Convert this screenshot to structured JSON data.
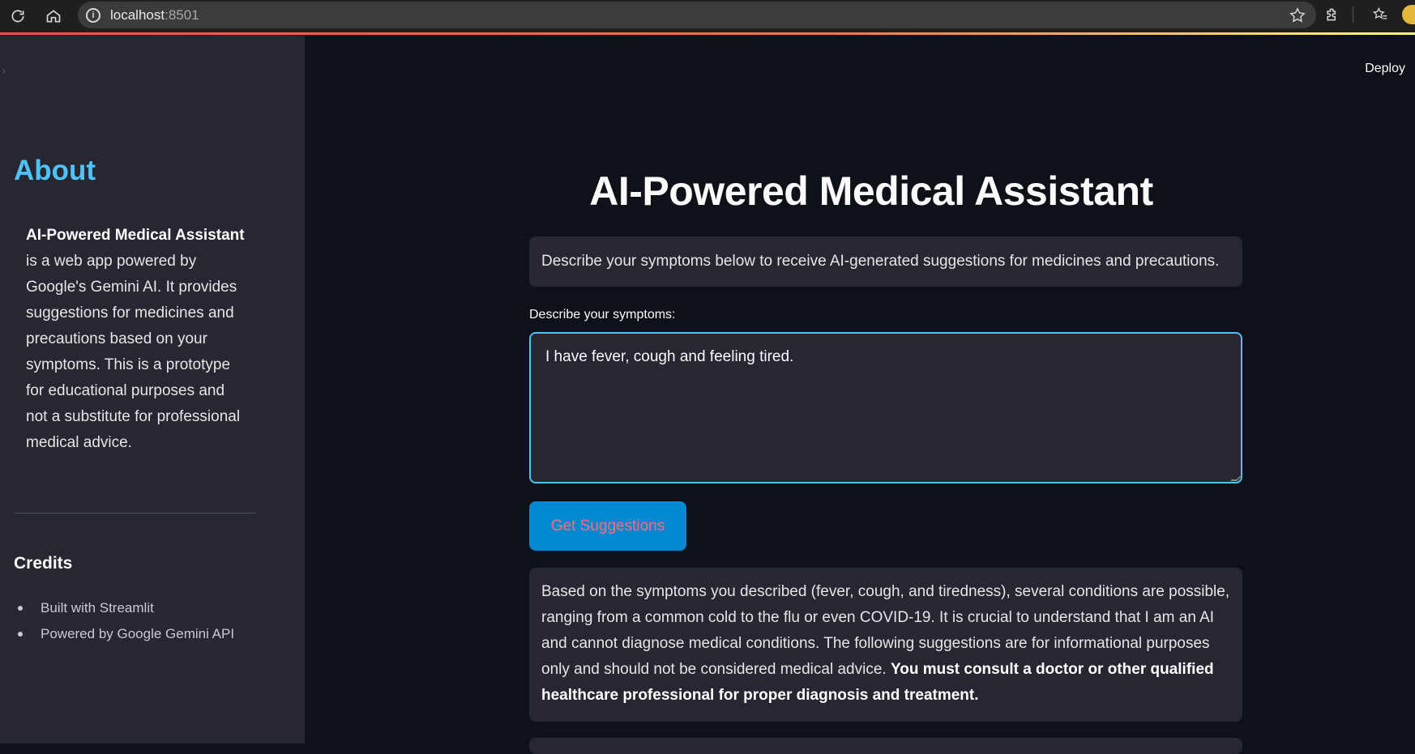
{
  "browser": {
    "url_host": "localhost",
    "url_port": ":8501"
  },
  "sidebar": {
    "about_title": "About",
    "about_app_name": "AI-Powered Medical Assistant",
    "about_text": "is a web app powered by Google's Gemini AI. It provides suggestions for medicines and precautions based on your symptoms. This is a prototype for educational purposes and not a substitute for professional medical advice.",
    "credits_title": "Credits",
    "credits_items": [
      "Built with Streamlit",
      "Powered by Google Gemini API"
    ]
  },
  "header": {
    "deploy_label": "Deploy"
  },
  "main": {
    "title": "AI-Powered Medical Assistant",
    "info_text": "Describe your symptoms below to receive AI-generated suggestions for medicines and precautions.",
    "symptoms_label": "Describe your symptoms:",
    "symptoms_value": "I have fever, cough and feeling tired.",
    "button_label": "Get Suggestions",
    "result_text": "Based on the symptoms you described (fever, cough, and tiredness), several conditions are possible, ranging from a common cold to the flu or even COVID-19. It is crucial to understand that I am an AI and cannot diagnose medical conditions. The following suggestions are for informational purposes only and should not be considered medical advice.",
    "result_bold_text": "You must consult a doctor or other qualified healthcare professional for proper diagnosis and treatment."
  },
  "colors": {
    "background": "#0e1117",
    "sidebar": "#262730",
    "accent_blue": "#4fc3f7",
    "button_bg": "#0288d1",
    "button_text": "#ff6b7a"
  }
}
